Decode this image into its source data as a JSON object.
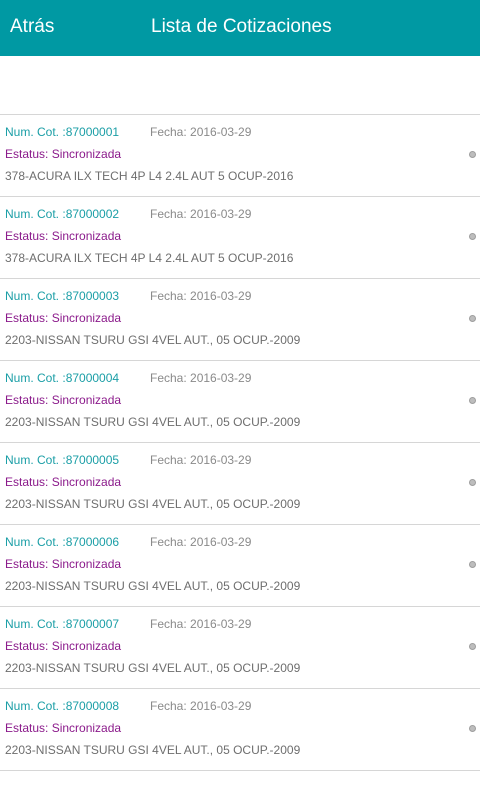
{
  "header": {
    "back_label": "Atrás",
    "title": "Lista de Cotizaciones"
  },
  "quotes": [
    {
      "num_label": "Num. Cot. :",
      "num": "87000001",
      "fecha": "Fecha: 2016-03-29",
      "estatus": "Estatus: Sincronizada",
      "vehiculo": "378-ACURA ILX TECH 4P L4 2.4L AUT 5 OCUP-2016"
    },
    {
      "num_label": "Num. Cot. :",
      "num": "87000002",
      "fecha": "Fecha: 2016-03-29",
      "estatus": "Estatus: Sincronizada",
      "vehiculo": "378-ACURA ILX TECH 4P L4 2.4L AUT 5 OCUP-2016"
    },
    {
      "num_label": "Num. Cot. :",
      "num": "87000003",
      "fecha": "Fecha: 2016-03-29",
      "estatus": "Estatus: Sincronizada",
      "vehiculo": "2203-NISSAN TSURU GSI 4VEL AUT., 05 OCUP.-2009"
    },
    {
      "num_label": "Num. Cot. :",
      "num": "87000004",
      "fecha": "Fecha: 2016-03-29",
      "estatus": "Estatus: Sincronizada",
      "vehiculo": "2203-NISSAN TSURU GSI 4VEL AUT., 05 OCUP.-2009"
    },
    {
      "num_label": "Num. Cot. :",
      "num": "87000005",
      "fecha": "Fecha: 2016-03-29",
      "estatus": "Estatus: Sincronizada",
      "vehiculo": "2203-NISSAN TSURU GSI 4VEL AUT., 05 OCUP.-2009"
    },
    {
      "num_label": "Num. Cot. :",
      "num": "87000006",
      "fecha": "Fecha: 2016-03-29",
      "estatus": "Estatus: Sincronizada",
      "vehiculo": "2203-NISSAN TSURU GSI 4VEL AUT., 05 OCUP.-2009"
    },
    {
      "num_label": "Num. Cot. :",
      "num": "87000007",
      "fecha": "Fecha: 2016-03-29",
      "estatus": "Estatus: Sincronizada",
      "vehiculo": "2203-NISSAN TSURU GSI 4VEL AUT., 05 OCUP.-2009"
    },
    {
      "num_label": "Num. Cot. :",
      "num": "87000008",
      "fecha": "Fecha: 2016-03-29",
      "estatus": "Estatus: Sincronizada",
      "vehiculo": "2203-NISSAN TSURU GSI 4VEL AUT., 05 OCUP.-2009"
    }
  ],
  "colors": {
    "appbar": "#0099a3",
    "quote_number": "#1a9ea6",
    "status": "#8b1a8b"
  },
  "icons": {
    "row_indicator": "radio-dot-icon"
  }
}
